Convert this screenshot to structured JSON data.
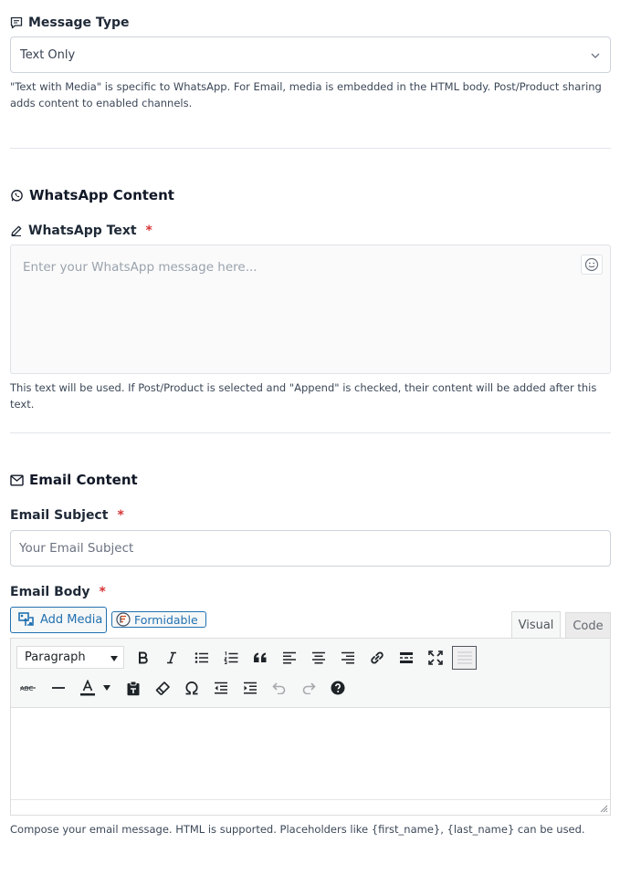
{
  "message_type": {
    "label": "Message Type",
    "selected": "Text Only",
    "help": "\"Text with Media\" is specific to WhatsApp. For Email, media is embedded in the HTML body. Post/Product sharing adds content to enabled channels."
  },
  "whatsapp": {
    "section_title": "WhatsApp Content",
    "text_label": "WhatsApp Text",
    "required_mark": "*",
    "placeholder": "Enter your WhatsApp message here...",
    "help": "This text will be used. If Post/Product is selected and \"Append\" is checked, their content will be added after this text."
  },
  "email": {
    "section_title": "Email Content",
    "subject_label": "Email Subject",
    "subject_placeholder": "Your Email Subject",
    "body_label": "Email Body",
    "required_mark": "*",
    "add_media": "Add Media",
    "formidable": "Formidable",
    "tab_visual": "Visual",
    "tab_code": "Code",
    "format_select": "Paragraph",
    "help": "Compose your email message. HTML is supported. Placeholders like {first_name}, {last_name} can be used."
  },
  "colors": {
    "accent": "#2271b1",
    "required": "#d63638"
  }
}
